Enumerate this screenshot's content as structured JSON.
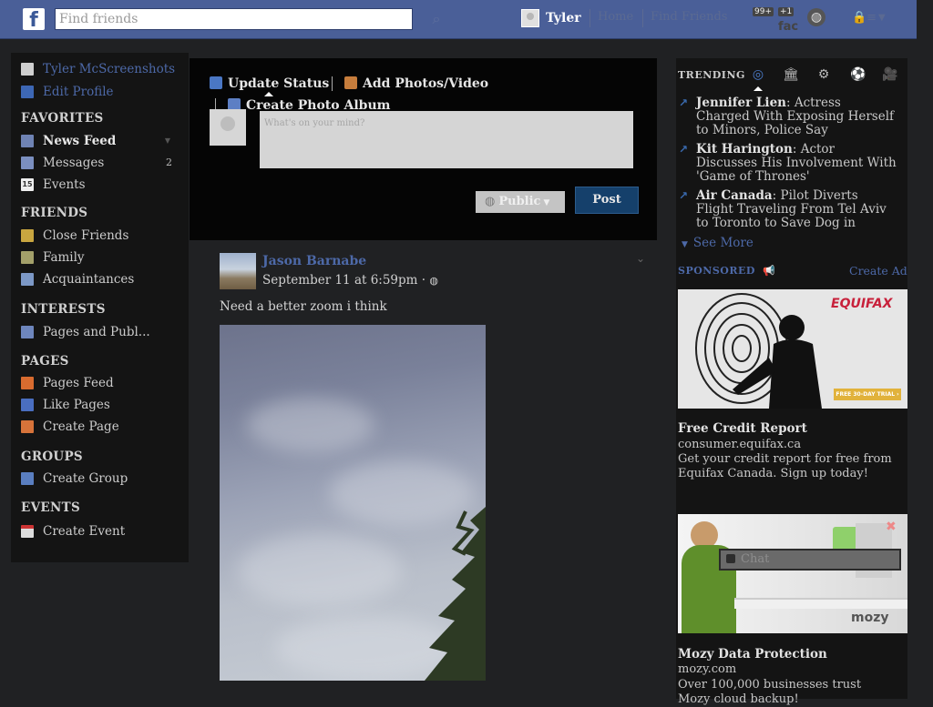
{
  "topbar": {
    "logo": "f",
    "search_placeholder": "Find friends",
    "search_icon": "magnifier-icon",
    "user_name": "Tyler",
    "home": "Home",
    "find_friends": "Find Friends",
    "notif_badge": "99+",
    "notif_badge2": "+1",
    "notif_glyph": "fac",
    "globe_icon": "globe-icon",
    "privacy_glyph": "🔒≡",
    "caret": "▼",
    "colors": {
      "bar": "#4a5f98"
    }
  },
  "leftnav": {
    "profile_name": "Tyler McScreenshots",
    "edit_profile": "Edit Profile",
    "sections": {
      "favorites": "FAVORITES",
      "friends": "FRIENDS",
      "interests": "INTERESTS",
      "pages": "PAGES",
      "groups": "GROUPS",
      "events": "EVENTS"
    },
    "items": {
      "news_feed": "News Feed",
      "news_feed_caret": "▼",
      "messages": "Messages",
      "messages_count": "2",
      "events": "Events",
      "events_icon_text": "15",
      "close_friends": "Close Friends",
      "family": "Family",
      "acquaintances": "Acquaintances",
      "pages_and_public": "Pages and Publ...",
      "pages_feed": "Pages Feed",
      "like_pages": "Like Pages",
      "create_page": "Create Page",
      "create_group": "Create Group",
      "create_event": "Create Event"
    }
  },
  "composer": {
    "update_status": "Update Status",
    "add_photos": "Add Photos/Video",
    "create_album": "Create Photo Album",
    "placeholder": "What's on your mind?",
    "audience": "Public",
    "post": "Post"
  },
  "post": {
    "author": "Jason Barnabe",
    "date": "September 11 at 6:59pm · ",
    "privacy_icon": "globe-icon",
    "text": "Need a better zoom i think"
  },
  "trending": {
    "title": "TRENDING",
    "tab_icons": [
      "trending-icon",
      "politics-icon",
      "science-icon",
      "sports-icon",
      "entertainment-icon"
    ],
    "items": [
      {
        "name": "Jennifer Lien",
        "text": ": Actress Charged With Exposing Herself to Minors, Police Say"
      },
      {
        "name": "Kit Harington",
        "text": ": Actor Discusses His Involvement With 'Game of Thrones'"
      },
      {
        "name": "Air Canada",
        "text": ": Pilot Diverts Flight Traveling From Tel Aviv to Toronto to Save Dog in Plane's"
      }
    ],
    "see_more": "See More"
  },
  "sponsored": {
    "title": "SPONSORED",
    "create_ad": "Create Ad",
    "ads": [
      {
        "logo": "EQUIFAX",
        "cta": "FREE 30-DAY TRIAL ›",
        "title": "Free Credit Report",
        "url": "consumer.equifax.ca",
        "desc": "Get your credit report for free from Equifax Canada. Sign up today!"
      },
      {
        "logo": "mozy",
        "title": "Mozy Data Protection",
        "url": "mozy.com",
        "desc": "Over 100,000 businesses trust Mozy cloud backup!"
      }
    ]
  },
  "chat": {
    "label": "Chat"
  }
}
